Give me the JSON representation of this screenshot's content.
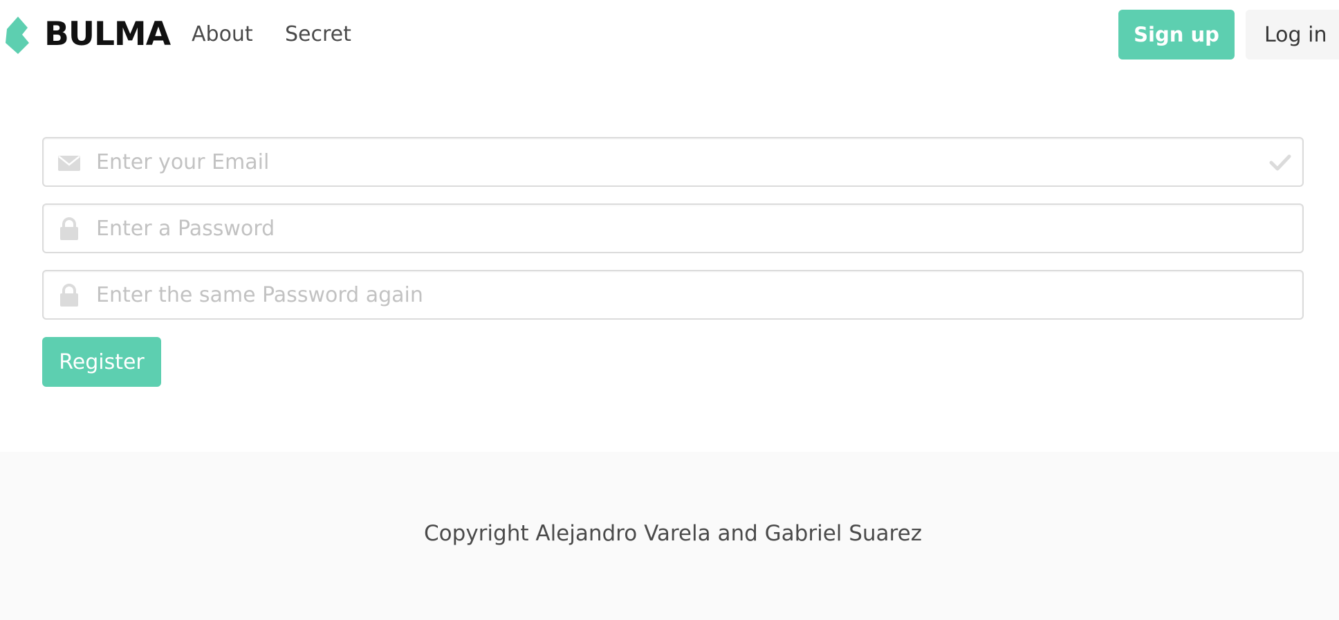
{
  "navbar": {
    "brand": "BULMA",
    "links": [
      {
        "label": "About"
      },
      {
        "label": "Secret"
      }
    ],
    "signup_label": "Sign up",
    "login_label": "Log in"
  },
  "form": {
    "email": {
      "placeholder": "Enter your Email",
      "value": "",
      "icon": "envelope-icon",
      "status_icon": "check-icon"
    },
    "password": {
      "placeholder": "Enter a Password",
      "value": "",
      "icon": "lock-icon"
    },
    "password_confirm": {
      "placeholder": "Enter the same Password again",
      "value": "",
      "icon": "lock-icon"
    },
    "register_label": "Register"
  },
  "footer": {
    "text": "Copyright Alejandro Varela and Gabriel Suarez"
  },
  "colors": {
    "primary": "#5dcfb0",
    "light": "#f5f5f5",
    "footer_bg": "#fafafa",
    "border": "#dbdbdb",
    "placeholder": "#c2c2c2",
    "icon": "#dbdbdb"
  }
}
